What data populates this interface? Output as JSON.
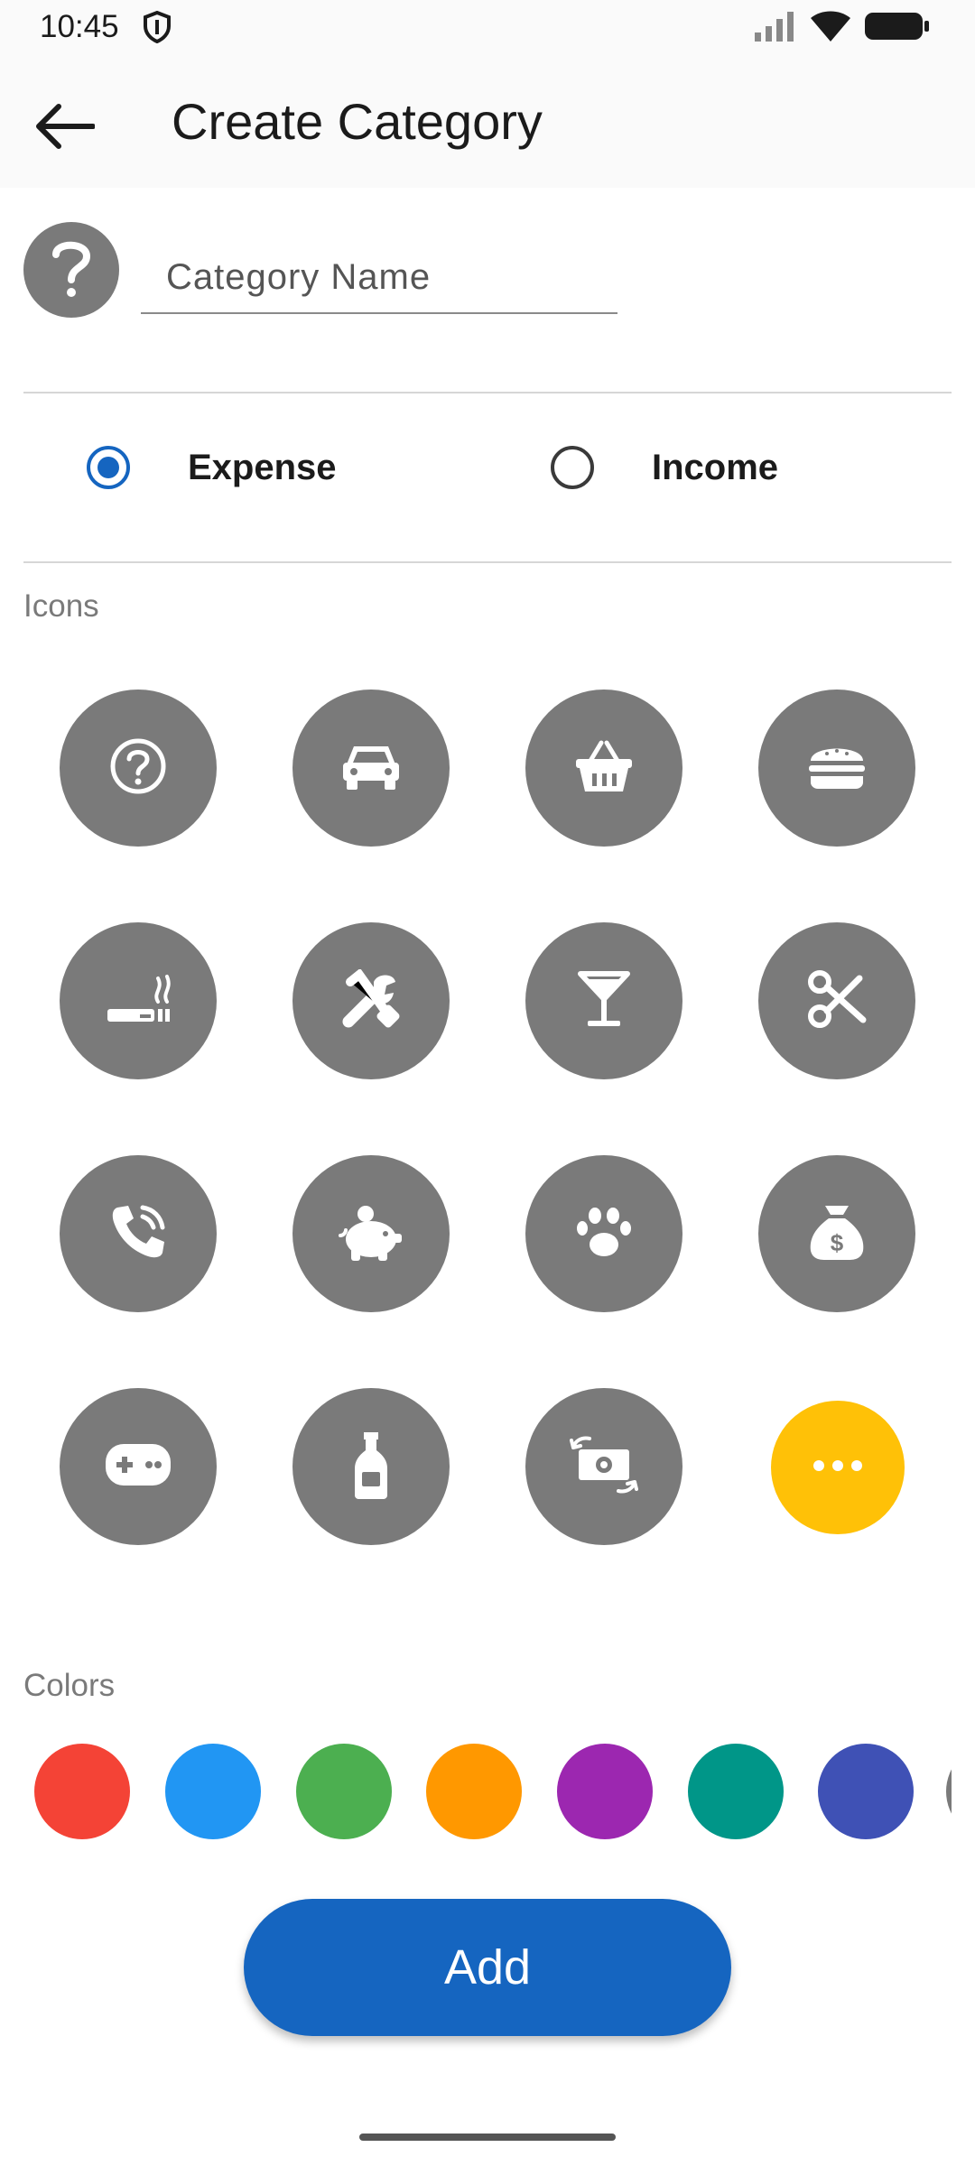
{
  "status_bar": {
    "time": "10:45",
    "icons": [
      "shield-icon",
      "signal-icon",
      "wifi-icon",
      "battery-icon"
    ]
  },
  "app_bar": {
    "back_icon": "arrow-left-icon",
    "title": "Create Category"
  },
  "name_field": {
    "selected_icon": "question-mark-icon",
    "placeholder": "Category Name",
    "value": ""
  },
  "type_selector": {
    "options": [
      {
        "label": "Expense",
        "selected": true
      },
      {
        "label": "Income",
        "selected": false
      }
    ]
  },
  "icons_section": {
    "label": "Icons",
    "items": [
      "question-circle-icon",
      "car-icon",
      "shopping-basket-icon",
      "burger-icon",
      "smoking-icon",
      "tools-icon",
      "cocktail-icon",
      "scissors-icon",
      "phone-call-icon",
      "piggy-bank-icon",
      "paw-icon",
      "money-bag-icon",
      "gamepad-icon",
      "bottle-icon",
      "money-exchange-icon",
      "more-icon"
    ],
    "more_color": "#ffc107",
    "icon_bg_color": "#7a7a7a"
  },
  "colors_section": {
    "label": "Colors",
    "swatches": [
      "#f44336",
      "#2196f3",
      "#4caf50",
      "#ff9800",
      "#9c27b0",
      "#009688",
      "#3f51b5",
      "#7a7a7a"
    ]
  },
  "add_button": {
    "label": "Add",
    "color": "#1565c0"
  }
}
